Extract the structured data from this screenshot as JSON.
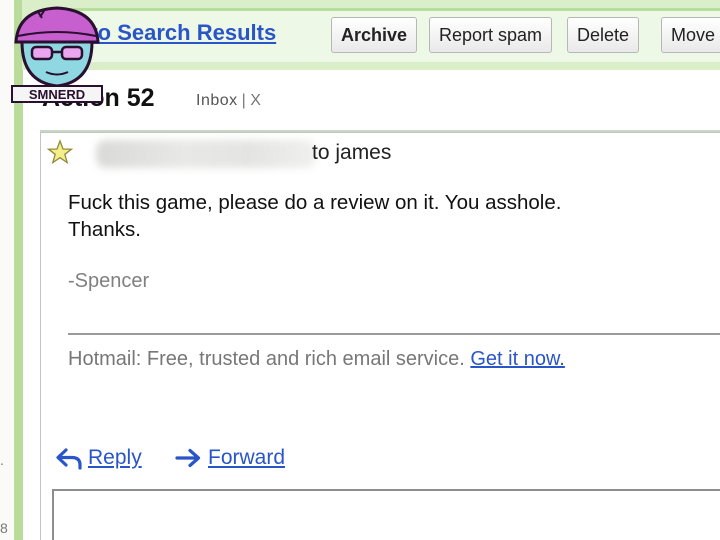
{
  "window": {
    "left_marker_top": ".",
    "left_marker_bottom": "8"
  },
  "toolbar": {
    "back_label": "k to Search Results",
    "archive_label": "Archive",
    "spam_label": "Report spam",
    "delete_label": "Delete",
    "move_label": "Move"
  },
  "message": {
    "subject": "Action 52",
    "label": "Inbox",
    "label_remove": "X",
    "recipient_line": "to james",
    "body_line1": "Fuck this game, please do a review on it. You asshole.",
    "body_line2": "Thanks.",
    "signature": "-Spencer",
    "footer_text": "Hotmail: Free, trusted and rich email service.",
    "footer_link": "Get it now."
  },
  "actions": {
    "reply": "Reply",
    "forward": "Forward"
  },
  "colors": {
    "link": "#2a55c8",
    "toolbar_bg": "#eef8e6",
    "accent_green": "#b9dc9a",
    "logo_pink": "#e7a0e8",
    "logo_teal": "#86d3de"
  },
  "icons": [
    "star-icon",
    "reply-arrow-icon",
    "forward-arrow-icon"
  ],
  "watermark": {
    "text": "SMNERD"
  }
}
